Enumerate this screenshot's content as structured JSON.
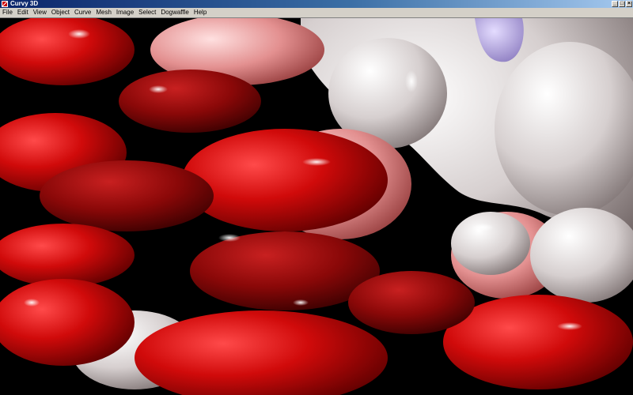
{
  "window": {
    "title": "Curvy 3D",
    "controls": {
      "minimize": "_",
      "maximize": "□",
      "close": "×"
    }
  },
  "menubar": {
    "items": [
      "File",
      "Edit",
      "View",
      "Object",
      "Curve",
      "Mesh",
      "Image",
      "Select",
      "Dogwaffle",
      "Help"
    ]
  },
  "viewport": {
    "background": "#000000",
    "colors": {
      "red_dark": "#6a0000",
      "red": "#d80a0a",
      "red_bright": "#ff2a2a",
      "pink": "#e8a0a0",
      "grey_light": "#d8d2d2",
      "lavender": "#b8a8e0"
    }
  }
}
